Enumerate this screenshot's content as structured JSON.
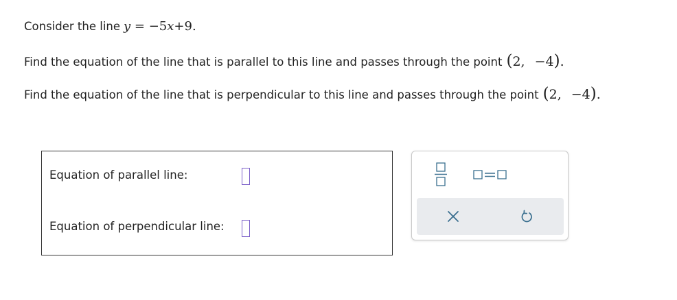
{
  "question": {
    "line1_text": "Consider the line",
    "equation": {
      "y": "y",
      "eq": " = −5",
      "x": "x",
      "rest": "+9."
    },
    "line2_text": "Find the equation of the line that is parallel to this line and passes through the point",
    "line3_text": "Find the equation of the line that is perpendicular to this line and passes through the point",
    "point": {
      "open": "(",
      "x": "2,",
      "y": "−4",
      "close": ")",
      "trail": "."
    }
  },
  "answers": {
    "parallel_label": "Equation of parallel line:",
    "perpendicular_label": "Equation of perpendicular line:"
  },
  "toolbar": {
    "icons": [
      "fraction-icon",
      "equals-template-icon",
      "clear-icon",
      "undo-icon"
    ],
    "accent_color": "#7a5ec8",
    "icon_color": "#3a6f8f"
  }
}
